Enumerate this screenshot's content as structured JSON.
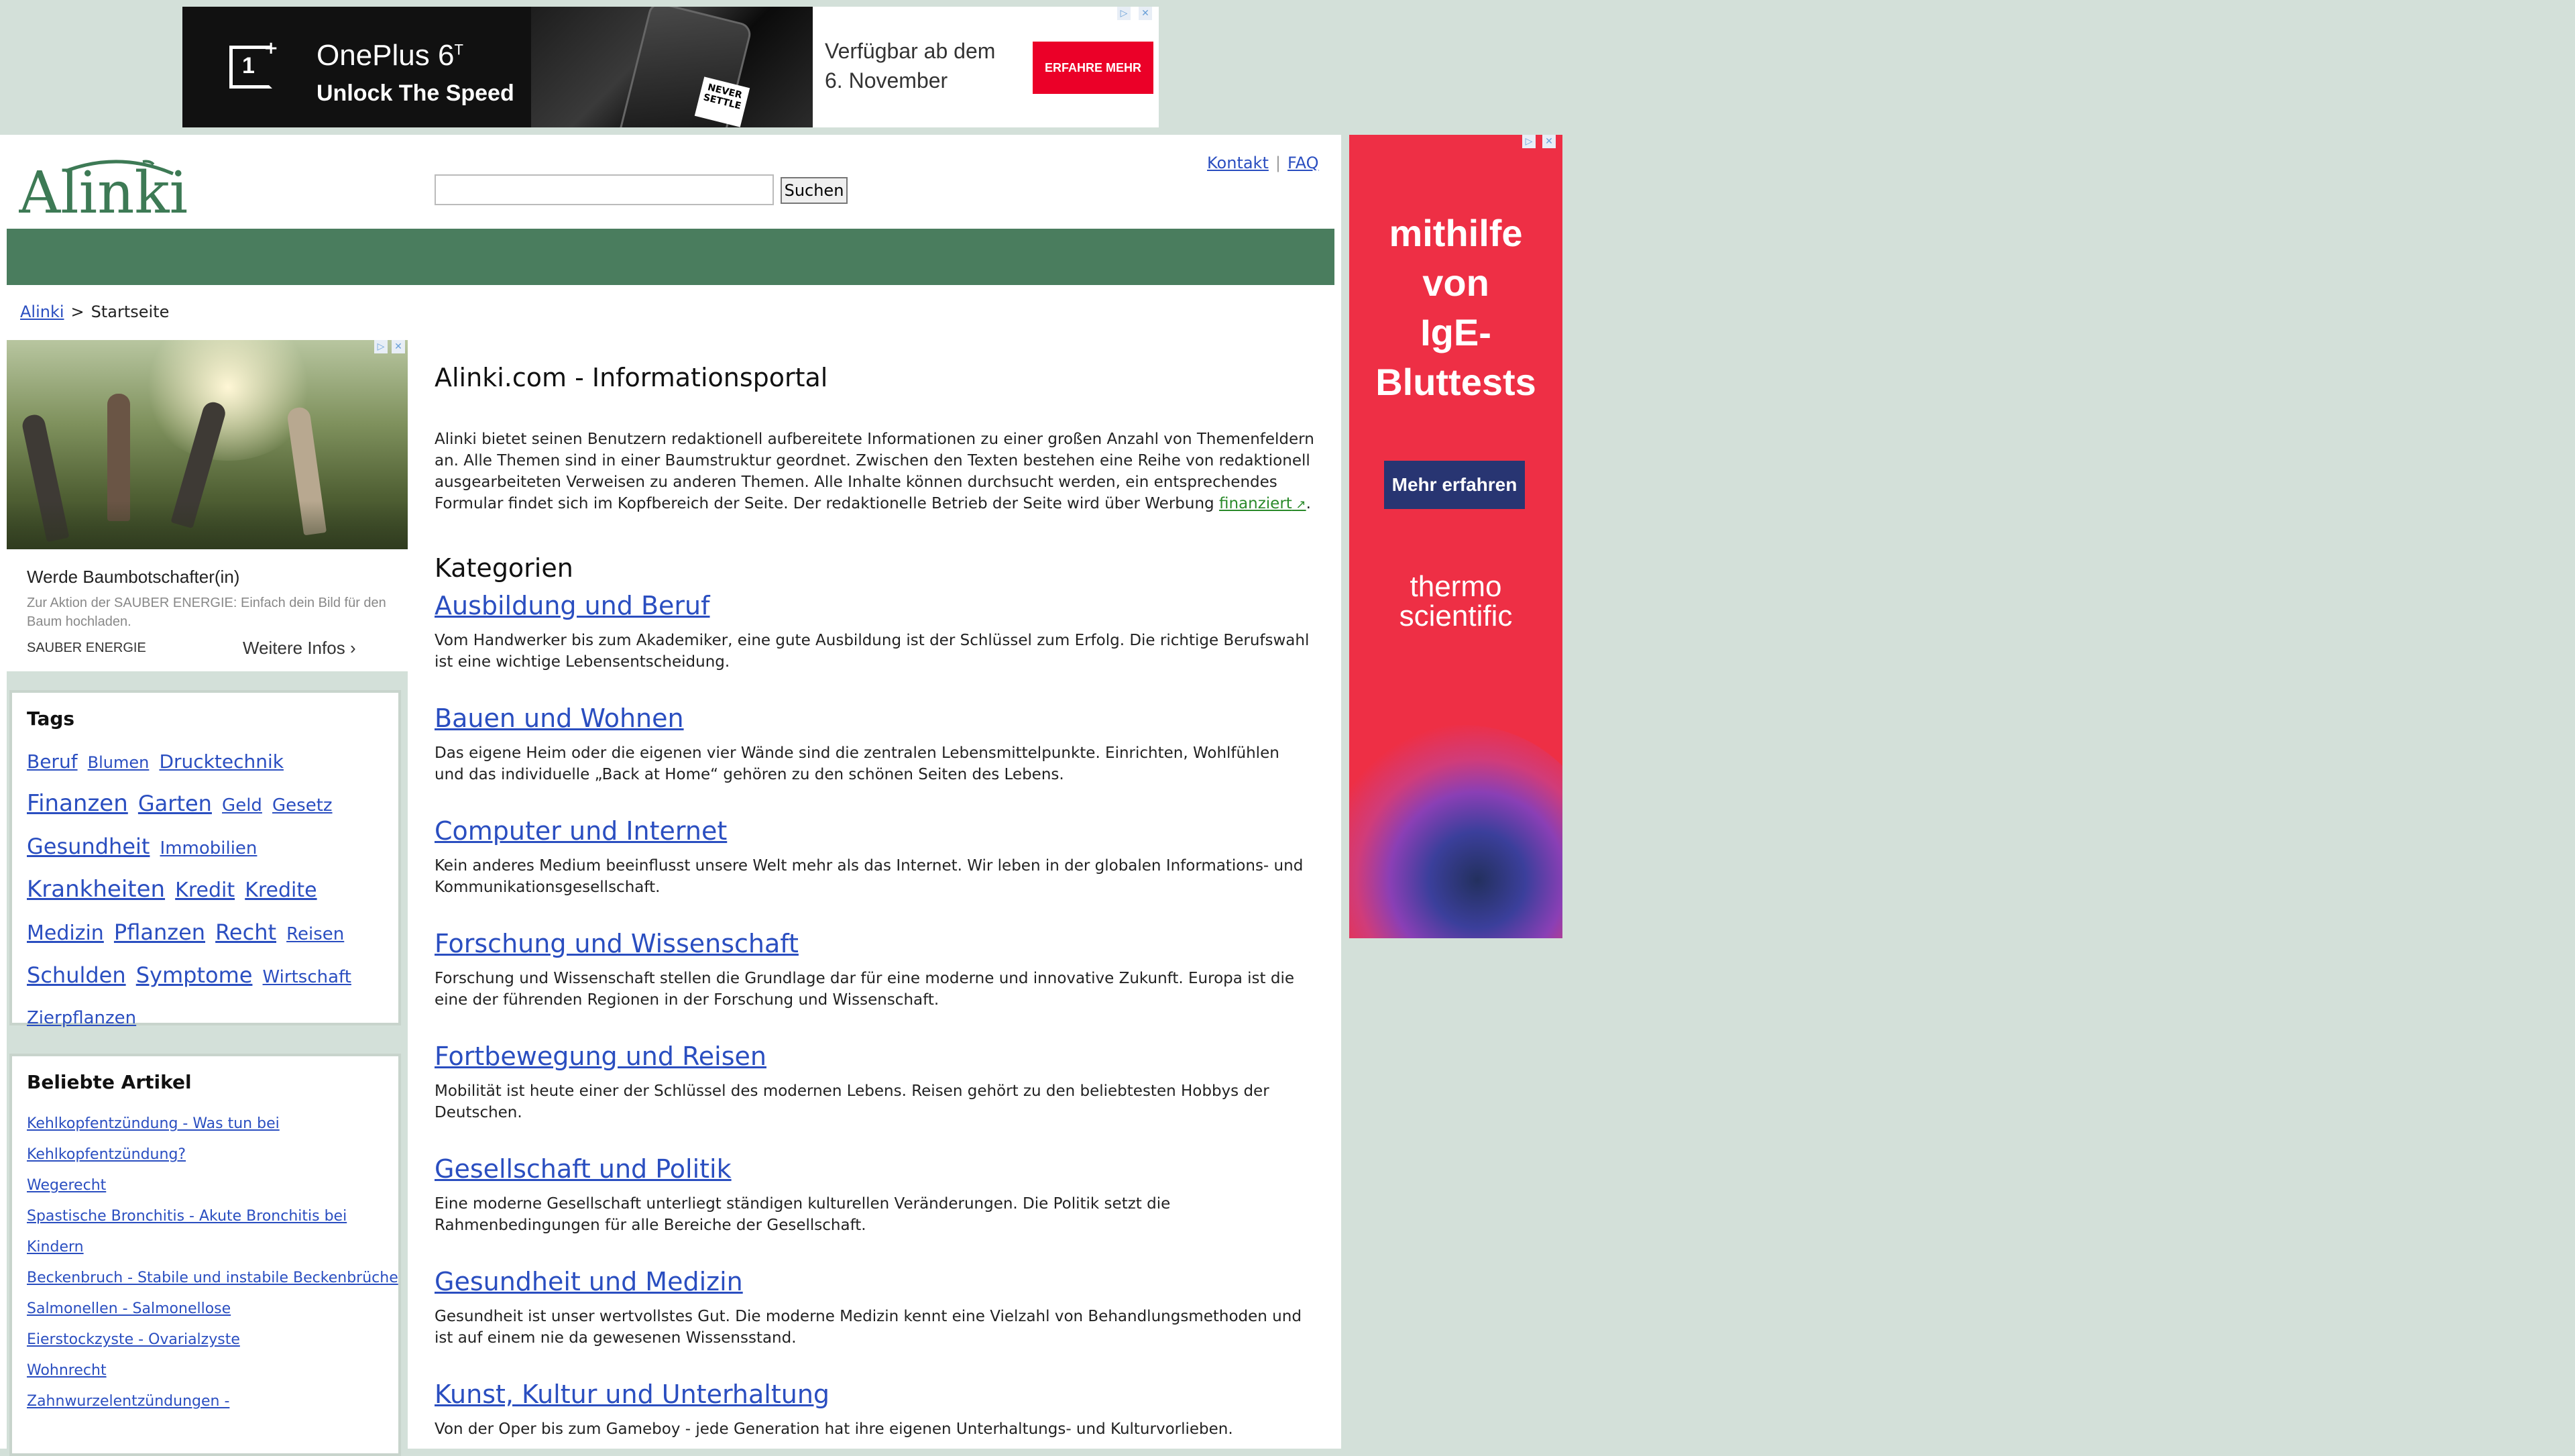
{
  "top_ad": {
    "brand": "OnePlus 6",
    "brand_sup": "T",
    "tagline": "Unlock The Speed",
    "stamp": "NEVER SETTLE",
    "availability_line1": "Verfügbar ab dem",
    "availability_line2": "6. November",
    "cta": "ERFAHRE MEHR",
    "colors": {
      "background": "#111111",
      "cta": "#eb0028"
    }
  },
  "header": {
    "logo_text": "Alinki",
    "search": {
      "value": "",
      "placeholder": ""
    },
    "search_button": "Suchen",
    "links": [
      "Kontakt",
      "FAQ"
    ],
    "link_separator": "|"
  },
  "colors": {
    "green_bar": "#4a7d5e",
    "page_background": "#d3e0d9",
    "link": "#2a4ec0"
  },
  "breadcrumb": {
    "root": "Alinki",
    "separator": ">",
    "current": "Startseite"
  },
  "sidebar_ad": {
    "title": "Werde Baumbotschafter(in)",
    "description": "Zur Aktion der SAUBER ENERGIE: Einfach dein Bild für den Baum hochladen.",
    "brand": "SAUBER ENERGIE",
    "more": "Weitere Infos"
  },
  "tags": {
    "title": "Tags",
    "items": [
      {
        "label": "Beruf",
        "size": 28
      },
      {
        "label": "Blumen",
        "size": 24
      },
      {
        "label": "Drucktechnik",
        "size": 28
      },
      {
        "label": "Finanzen",
        "size": 34
      },
      {
        "label": "Garten",
        "size": 32
      },
      {
        "label": "Geld",
        "size": 26
      },
      {
        "label": "Gesetz",
        "size": 26
      },
      {
        "label": "Gesundheit",
        "size": 32
      },
      {
        "label": "Immobilien",
        "size": 26
      },
      {
        "label": "Krankheiten",
        "size": 34
      },
      {
        "label": "Kredit",
        "size": 30
      },
      {
        "label": "Kredite",
        "size": 30
      },
      {
        "label": "Medizin",
        "size": 30
      },
      {
        "label": "Pflanzen",
        "size": 32
      },
      {
        "label": "Recht",
        "size": 32
      },
      {
        "label": "Reisen",
        "size": 26
      },
      {
        "label": "Schulden",
        "size": 32
      },
      {
        "label": "Symptome",
        "size": 32
      },
      {
        "label": "Wirtschaft",
        "size": 26
      },
      {
        "label": "Zierpflanzen",
        "size": 26
      }
    ]
  },
  "popular": {
    "title": "Beliebte Artikel",
    "items": [
      "Kehlkopfentzündung - Was tun bei Kehlkopfentzündung?",
      "Wegerecht",
      "Spastische Bronchitis - Akute Bronchitis bei Kindern",
      "Beckenbruch - Stabile und instabile Beckenbrüche",
      "Salmonellen - Salmonellose",
      "Eierstockzyste - Ovarialzyste",
      "Wohnrecht",
      "Zahnwurzelentzündungen -"
    ]
  },
  "main": {
    "title": "Alinki.com - Informationsportal",
    "intro_before_link": "Alinki bietet seinen Benutzern redaktionell aufbereitete Informationen zu einer großen Anzahl von Themenfeldern an. Alle Themen sind in einer Baumstruktur geordnet. Zwischen den Texten bestehen eine Reihe von redaktionell ausgearbeiteten Verweisen zu anderen Themen. Alle Inhalte können durchsucht werden, ein entsprechendes Formular findet sich im Kopfbereich der Seite. Der redaktionelle Betrieb der Seite wird über Werbung",
    "intro_link": "finanziert",
    "intro_after_link": ".",
    "categories_title": "Kategorien",
    "categories": [
      {
        "title": "Ausbildung und Beruf",
        "text": "Vom Handwerker bis zum Akademiker, eine gute Ausbildung ist der Schlüssel zum Erfolg. Die richtige Berufswahl ist eine wichtige Lebensentscheidung."
      },
      {
        "title": "Bauen und Wohnen",
        "text": "Das eigene Heim oder die eigenen vier Wände sind die zentralen Lebensmittelpunkte. Einrichten, Wohlfühlen und das individuelle „Back at Home“ gehören zu den schönen Seiten des Lebens."
      },
      {
        "title": "Computer und Internet",
        "text": "Kein anderes Medium beeinflusst unsere Welt mehr als das Internet. Wir leben in der globalen Informations- und Kommunikationsgesellschaft."
      },
      {
        "title": "Forschung und Wissenschaft",
        "text": "Forschung und Wissenschaft stellen die Grundlage dar für eine moderne und innovative Zukunft. Europa ist die eine der führenden Regionen in der Forschung und Wissenschaft."
      },
      {
        "title": "Fortbewegung und Reisen",
        "text": "Mobilität ist heute einer der Schlüssel des modernen Lebens. Reisen gehört zu den beliebtesten Hobbys der Deutschen."
      },
      {
        "title": "Gesellschaft und Politik",
        "text": "Eine moderne Gesellschaft unterliegt ständigen kulturellen Veränderungen. Die Politik setzt die Rahmenbedingungen für alle Bereiche der Gesellschaft."
      },
      {
        "title": "Gesundheit und Medizin",
        "text": "Gesundheit ist unser wertvollstes Gut. Die moderne Medizin kennt eine Vielzahl von Behandlungsmethoden und ist auf einem nie da gewesenen Wissensstand."
      },
      {
        "title": "Kunst, Kultur und Unterhaltung",
        "text": "Von der Oper bis zum Gameboy - jede Generation hat ihre eigenen Unterhaltungs- und Kulturvorlieben."
      }
    ]
  },
  "right_ad": {
    "headline": [
      "mithilfe",
      "von",
      "IgE-",
      "Bluttests"
    ],
    "button": "Mehr erfahren",
    "brand_line1": "thermo",
    "brand_line2": "scientific",
    "colors": {
      "background": "#ee2f45",
      "button": "#283572"
    }
  }
}
